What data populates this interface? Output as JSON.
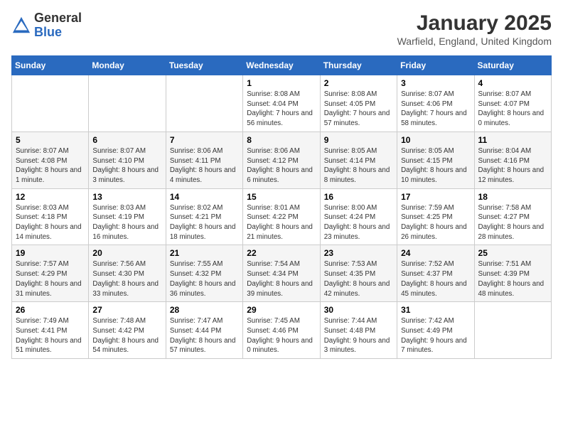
{
  "header": {
    "logo_general": "General",
    "logo_blue": "Blue",
    "title": "January 2025",
    "subtitle": "Warfield, England, United Kingdom"
  },
  "weekdays": [
    "Sunday",
    "Monday",
    "Tuesday",
    "Wednesday",
    "Thursday",
    "Friday",
    "Saturday"
  ],
  "weeks": [
    [
      {
        "day": "",
        "info": ""
      },
      {
        "day": "",
        "info": ""
      },
      {
        "day": "",
        "info": ""
      },
      {
        "day": "1",
        "info": "Sunrise: 8:08 AM\nSunset: 4:04 PM\nDaylight: 7 hours and 56 minutes."
      },
      {
        "day": "2",
        "info": "Sunrise: 8:08 AM\nSunset: 4:05 PM\nDaylight: 7 hours and 57 minutes."
      },
      {
        "day": "3",
        "info": "Sunrise: 8:07 AM\nSunset: 4:06 PM\nDaylight: 7 hours and 58 minutes."
      },
      {
        "day": "4",
        "info": "Sunrise: 8:07 AM\nSunset: 4:07 PM\nDaylight: 8 hours and 0 minutes."
      }
    ],
    [
      {
        "day": "5",
        "info": "Sunrise: 8:07 AM\nSunset: 4:08 PM\nDaylight: 8 hours and 1 minute."
      },
      {
        "day": "6",
        "info": "Sunrise: 8:07 AM\nSunset: 4:10 PM\nDaylight: 8 hours and 3 minutes."
      },
      {
        "day": "7",
        "info": "Sunrise: 8:06 AM\nSunset: 4:11 PM\nDaylight: 8 hours and 4 minutes."
      },
      {
        "day": "8",
        "info": "Sunrise: 8:06 AM\nSunset: 4:12 PM\nDaylight: 8 hours and 6 minutes."
      },
      {
        "day": "9",
        "info": "Sunrise: 8:05 AM\nSunset: 4:14 PM\nDaylight: 8 hours and 8 minutes."
      },
      {
        "day": "10",
        "info": "Sunrise: 8:05 AM\nSunset: 4:15 PM\nDaylight: 8 hours and 10 minutes."
      },
      {
        "day": "11",
        "info": "Sunrise: 8:04 AM\nSunset: 4:16 PM\nDaylight: 8 hours and 12 minutes."
      }
    ],
    [
      {
        "day": "12",
        "info": "Sunrise: 8:03 AM\nSunset: 4:18 PM\nDaylight: 8 hours and 14 minutes."
      },
      {
        "day": "13",
        "info": "Sunrise: 8:03 AM\nSunset: 4:19 PM\nDaylight: 8 hours and 16 minutes."
      },
      {
        "day": "14",
        "info": "Sunrise: 8:02 AM\nSunset: 4:21 PM\nDaylight: 8 hours and 18 minutes."
      },
      {
        "day": "15",
        "info": "Sunrise: 8:01 AM\nSunset: 4:22 PM\nDaylight: 8 hours and 21 minutes."
      },
      {
        "day": "16",
        "info": "Sunrise: 8:00 AM\nSunset: 4:24 PM\nDaylight: 8 hours and 23 minutes."
      },
      {
        "day": "17",
        "info": "Sunrise: 7:59 AM\nSunset: 4:25 PM\nDaylight: 8 hours and 26 minutes."
      },
      {
        "day": "18",
        "info": "Sunrise: 7:58 AM\nSunset: 4:27 PM\nDaylight: 8 hours and 28 minutes."
      }
    ],
    [
      {
        "day": "19",
        "info": "Sunrise: 7:57 AM\nSunset: 4:29 PM\nDaylight: 8 hours and 31 minutes."
      },
      {
        "day": "20",
        "info": "Sunrise: 7:56 AM\nSunset: 4:30 PM\nDaylight: 8 hours and 33 minutes."
      },
      {
        "day": "21",
        "info": "Sunrise: 7:55 AM\nSunset: 4:32 PM\nDaylight: 8 hours and 36 minutes."
      },
      {
        "day": "22",
        "info": "Sunrise: 7:54 AM\nSunset: 4:34 PM\nDaylight: 8 hours and 39 minutes."
      },
      {
        "day": "23",
        "info": "Sunrise: 7:53 AM\nSunset: 4:35 PM\nDaylight: 8 hours and 42 minutes."
      },
      {
        "day": "24",
        "info": "Sunrise: 7:52 AM\nSunset: 4:37 PM\nDaylight: 8 hours and 45 minutes."
      },
      {
        "day": "25",
        "info": "Sunrise: 7:51 AM\nSunset: 4:39 PM\nDaylight: 8 hours and 48 minutes."
      }
    ],
    [
      {
        "day": "26",
        "info": "Sunrise: 7:49 AM\nSunset: 4:41 PM\nDaylight: 8 hours and 51 minutes."
      },
      {
        "day": "27",
        "info": "Sunrise: 7:48 AM\nSunset: 4:42 PM\nDaylight: 8 hours and 54 minutes."
      },
      {
        "day": "28",
        "info": "Sunrise: 7:47 AM\nSunset: 4:44 PM\nDaylight: 8 hours and 57 minutes."
      },
      {
        "day": "29",
        "info": "Sunrise: 7:45 AM\nSunset: 4:46 PM\nDaylight: 9 hours and 0 minutes."
      },
      {
        "day": "30",
        "info": "Sunrise: 7:44 AM\nSunset: 4:48 PM\nDaylight: 9 hours and 3 minutes."
      },
      {
        "day": "31",
        "info": "Sunrise: 7:42 AM\nSunset: 4:49 PM\nDaylight: 9 hours and 7 minutes."
      },
      {
        "day": "",
        "info": ""
      }
    ]
  ]
}
